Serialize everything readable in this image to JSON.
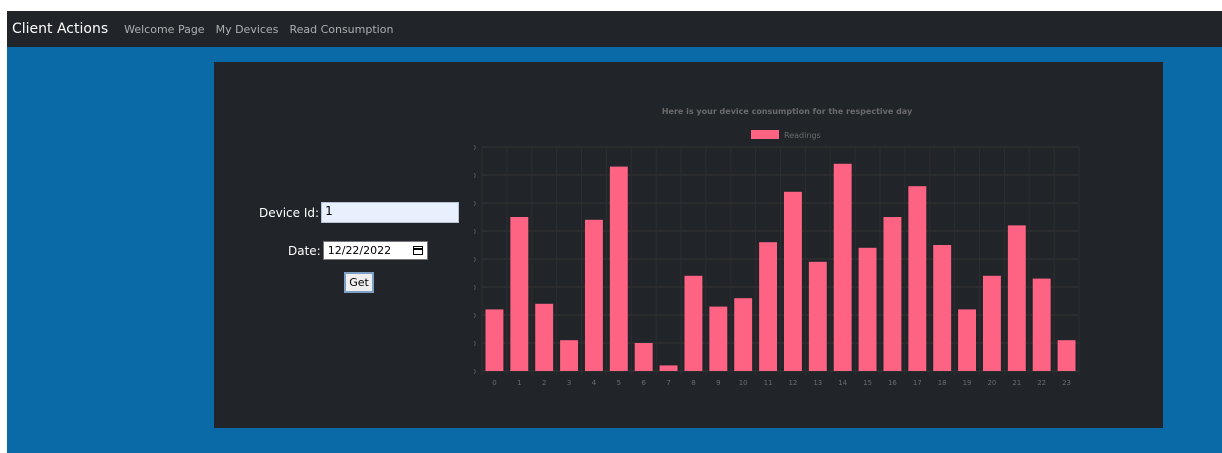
{
  "navbar": {
    "brand": "Client Actions",
    "links": [
      "Welcome Page",
      "My Devices",
      "Read Consumption"
    ]
  },
  "form": {
    "device_id_label": "Device Id:",
    "device_id_value": "1",
    "date_label": "Date:",
    "date_value": "12/22/2022",
    "get_label": "Get"
  },
  "colors": {
    "navbar": "#212529",
    "page_background": "#0a6aa8",
    "panel": "#212529",
    "bar": "#ff6384"
  },
  "chart_data": {
    "type": "bar",
    "title": "Here is your device consumption for the respective day",
    "legend_position": "top",
    "grid": true,
    "categories": [
      "0",
      "1",
      "2",
      "3",
      "4",
      "5",
      "6",
      "7",
      "8",
      "9",
      "10",
      "11",
      "12",
      "13",
      "14",
      "15",
      "16",
      "17",
      "18",
      "19",
      "20",
      "21",
      "22",
      "23"
    ],
    "series": [
      {
        "name": "Readings",
        "values": [
          22,
          55,
          24,
          11,
          54,
          73,
          10,
          2,
          34,
          23,
          26,
          46,
          64,
          39,
          74,
          44,
          55,
          66,
          45,
          22,
          34,
          52,
          33,
          11
        ]
      }
    ],
    "ylim": [
      0,
      80
    ],
    "yticks": [
      0,
      10,
      20,
      30,
      40,
      50,
      60,
      70,
      80
    ]
  }
}
